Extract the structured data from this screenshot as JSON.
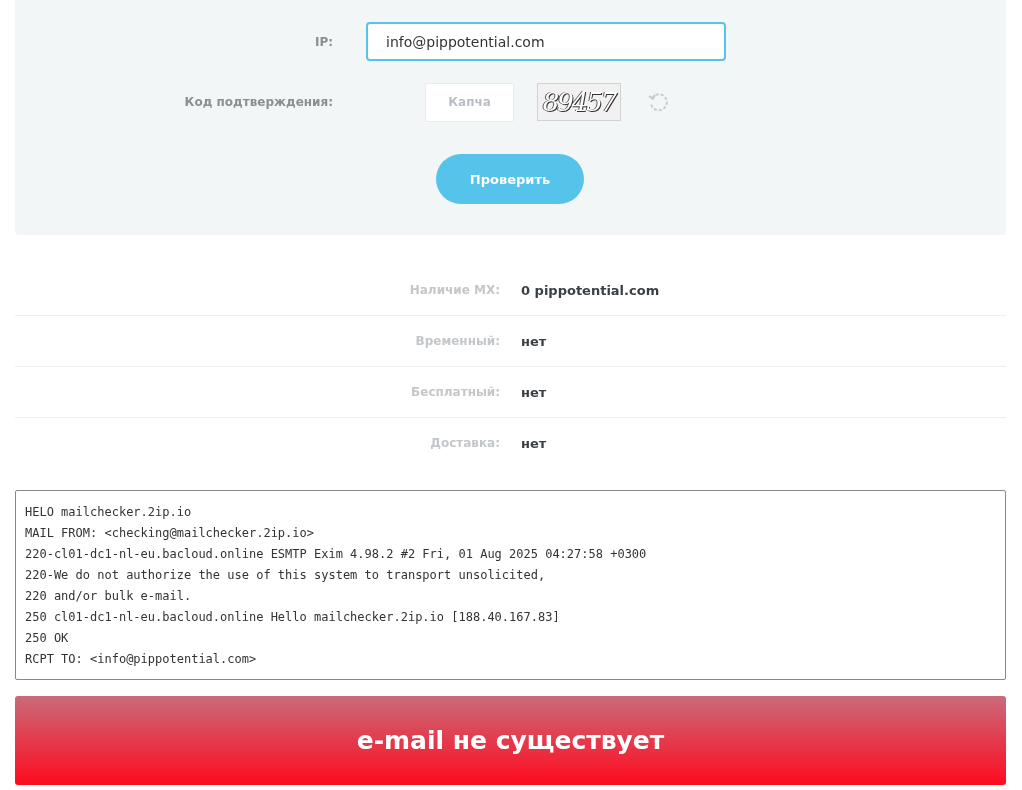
{
  "form": {
    "ip_label": "IP:",
    "ip_value": "info@pippotential.com",
    "captcha_label": "Код подтверждения:",
    "captcha_placeholder": "Капча",
    "captcha_image_text": "89457",
    "submit": "Проверить"
  },
  "results": [
    {
      "label": "Наличие MX:",
      "value": "**0** pippotential.com"
    },
    {
      "label": "Временный:",
      "value": "нет"
    },
    {
      "label": "Бесплатный:",
      "value": "нет"
    },
    {
      "label": "Доставка:",
      "value": "нет"
    }
  ],
  "log": [
    "HELO mailchecker.2ip.io",
    "MAIL FROM: <checking@mailchecker.2ip.io>",
    "220-cl01-dc1-nl-eu.bacloud.online ESMTP Exim 4.98.2 #2 Fri, 01 Aug 2025 04:27:58 +0300",
    "220-We do not authorize the use of this system to transport unsolicited,",
    "220 and/or bulk e-mail.",
    "250 cl01-dc1-nl-eu.bacloud.online Hello mailchecker.2ip.io [188.40.167.83]",
    "250 OK",
    "RCPT TO: <info@pippotential.com>"
  ],
  "verdict": {
    "text": "e-mail не существует",
    "kind": "error"
  }
}
